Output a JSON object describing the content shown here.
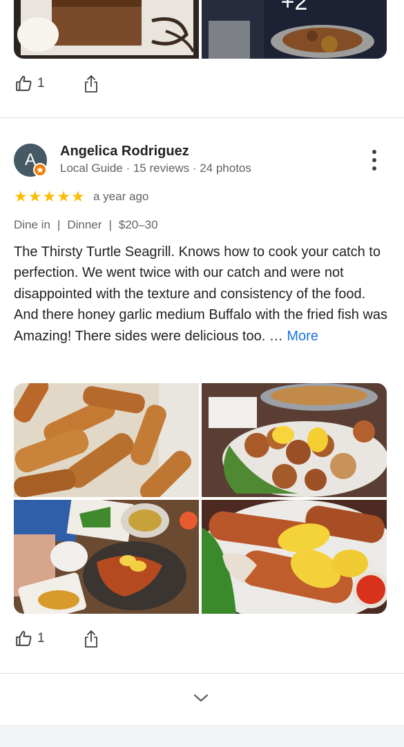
{
  "top_review": {
    "likes": "1",
    "more_photos_label": "+2"
  },
  "review": {
    "avatar_initial": "A",
    "reviewer_name": "Angelica Rodriguez",
    "reviewer_meta": "Local Guide · 15 reviews · 24 photos",
    "rating": 5,
    "stars": [
      "★",
      "★",
      "★",
      "★",
      "★"
    ],
    "time_ago": "a year ago",
    "tags": [
      "Dine in",
      "|",
      "Dinner",
      "|",
      "$20–30"
    ],
    "text": "The Thirsty Turtle Seagrill. Knows how to cook your catch to perfection. We went twice with our catch and were not disappointed with the texture and consistency of the food. And there honey garlic medium Buffalo with the fried fish was Amazing! There sides were delicious too. …",
    "more_label": "More",
    "likes": "1"
  },
  "icons": {
    "like": "thumbs-up-icon",
    "share": "share-icon",
    "menu": "more-vert-icon",
    "expand": "chevron-down-icon",
    "badge": "local-guide-star-icon"
  },
  "colors": {
    "star": "#fbbc04",
    "link": "#1a73e8",
    "avatar": "#455a64",
    "badge": "#f57c00"
  }
}
